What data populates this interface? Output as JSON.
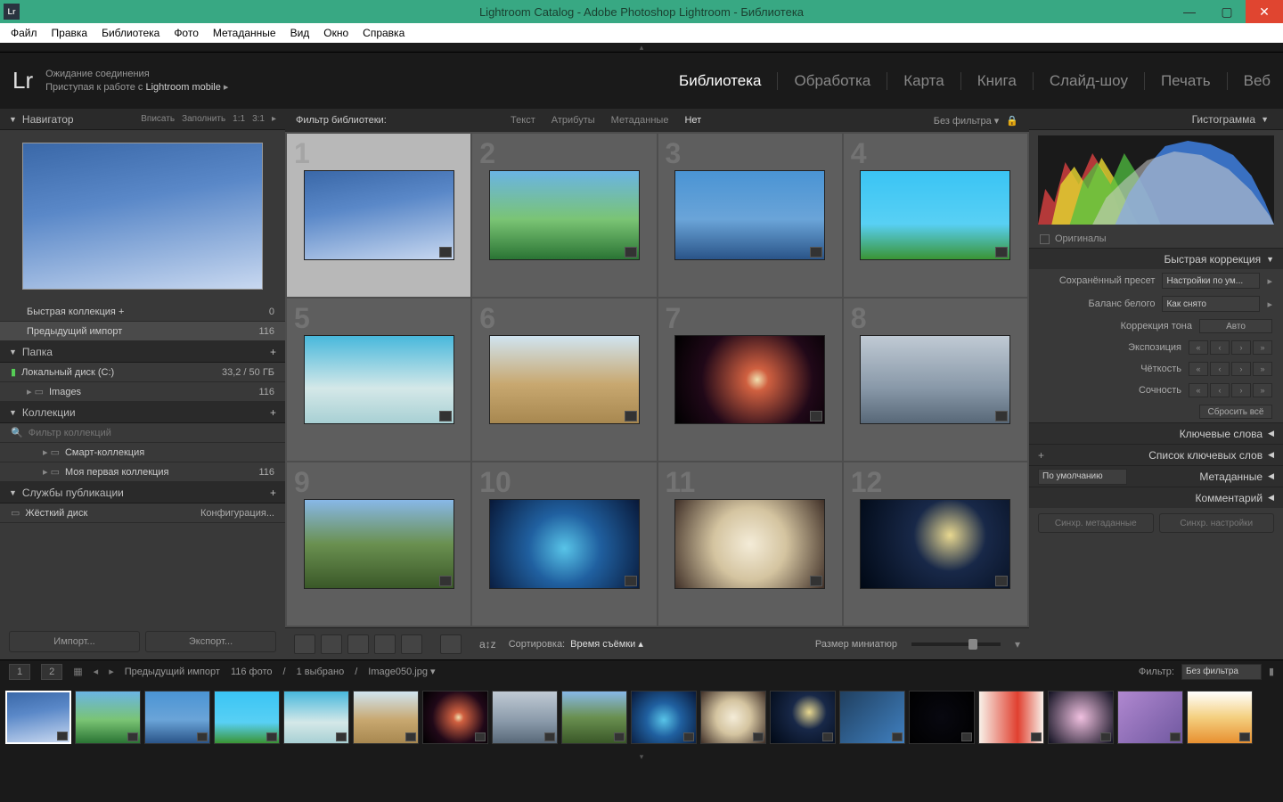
{
  "window": {
    "title": "Lightroom Catalog - Adobe Photoshop Lightroom - Библиотека",
    "logo": "Lr"
  },
  "menu": [
    "Файл",
    "Правка",
    "Библиотека",
    "Фото",
    "Метаданные",
    "Вид",
    "Окно",
    "Справка"
  ],
  "status": {
    "line1": "Ожидание соединения",
    "line2_a": "Приступая к работе с ",
    "line2_b": "Lightroom mobile",
    "arrow": "▸"
  },
  "modules": [
    "Библиотека",
    "Обработка",
    "Карта",
    "Книга",
    "Слайд-шоу",
    "Печать",
    "Веб"
  ],
  "modules_active": 0,
  "navigator": {
    "title": "Навигатор",
    "opts": [
      "Вписать",
      "Заполнить",
      "1:1",
      "3:1"
    ]
  },
  "catalog_rows": [
    {
      "label": "Быстрая коллекция  +",
      "count": "0"
    },
    {
      "label": "Предыдущий импорт",
      "count": "116",
      "sel": true
    }
  ],
  "folders": {
    "title": "Папка",
    "disk": "Локальный диск (C:)",
    "disk_info": "33,2 / 50 ГБ",
    "folder": "Images",
    "folder_count": "116"
  },
  "collections": {
    "title": "Коллекции",
    "filter_ph": "Фильтр коллекций",
    "items": [
      {
        "label": "Смарт-коллекция",
        "count": ""
      },
      {
        "label": "Моя первая коллекция",
        "count": "116"
      }
    ]
  },
  "publish": {
    "title": "Службы публикации",
    "hd": "Жёсткий диск",
    "cfg": "Конфигурация..."
  },
  "left_btns": {
    "import": "Импорт...",
    "export": "Экспорт..."
  },
  "filter_bar": {
    "label": "Фильтр библиотеки:",
    "items": [
      "Текст",
      "Атрибуты",
      "Метаданные",
      "Нет"
    ],
    "active": 3,
    "preset": "Без фильтра"
  },
  "grid": {
    "count": 12,
    "selected": 1
  },
  "toolbar": {
    "sort_lbl": "Сортировка:",
    "sort_val": "Время съёмки",
    "size_lbl": "Размер миниатюр"
  },
  "right": {
    "histogram": "Гистограмма",
    "originals": "Оригиналы",
    "quick": "Быстрая коррекция",
    "preset_lbl": "Сохранённый пресет",
    "preset_val": "Настройки по ум...",
    "wb_lbl": "Баланс белого",
    "wb_val": "Как снято",
    "tone_lbl": "Коррекция тона",
    "tone_btn": "Авто",
    "sliders": [
      "Экспозиция",
      "Чёткость",
      "Сочность"
    ],
    "reset": "Сбросить всё",
    "panels": [
      "Ключевые слова",
      "Список ключевых слов",
      "Метаданные",
      "Комментарий"
    ],
    "meta_preset": "По умолчанию",
    "sync_meta": "Синхр. метаданные",
    "sync_set": "Синхр. настройки"
  },
  "info": {
    "pages": [
      "1",
      "2"
    ],
    "crumb": "Предыдущий импорт",
    "count": "116 фото",
    "sel": "1 выбрано",
    "file": "Image050.jpg",
    "filter_lbl": "Фильтр:",
    "filter_val": "Без фильтра"
  },
  "film_gradients": [
    "g1",
    "g2",
    "g3",
    "g4",
    "g5",
    "g6",
    "g7",
    "g8",
    "g9",
    "g10",
    "g11",
    "g12",
    "g13",
    "g14",
    "g15",
    "g16",
    "g17",
    "g18"
  ]
}
